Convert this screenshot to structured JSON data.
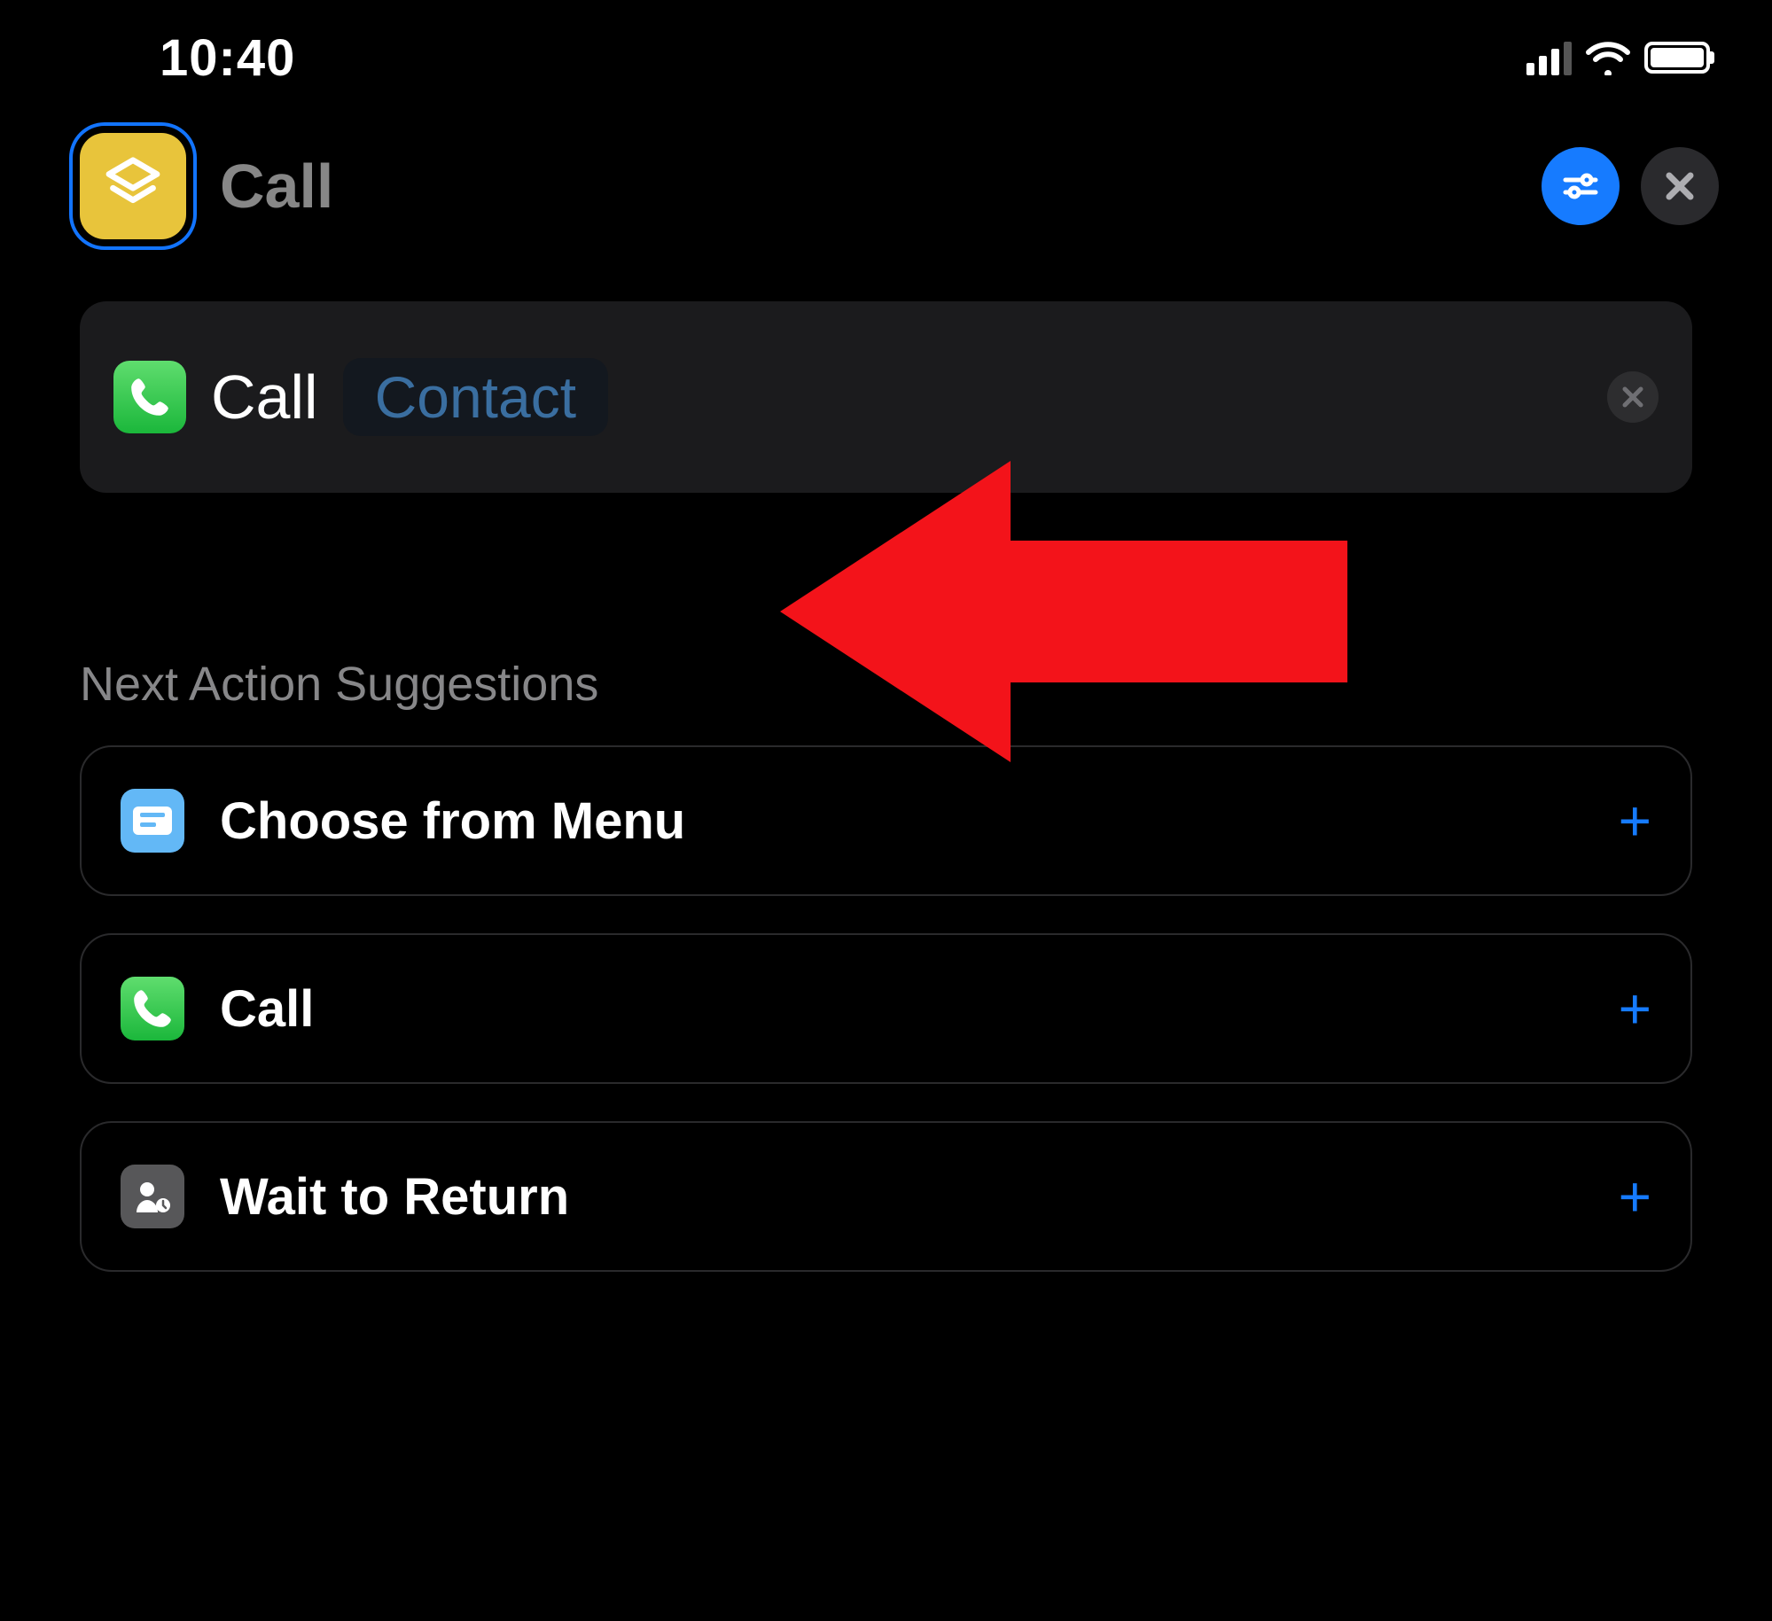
{
  "status": {
    "time": "10:40"
  },
  "header": {
    "title": "Call"
  },
  "action": {
    "icon": "phone-icon",
    "label": "Call",
    "parameter_token": "Contact"
  },
  "suggestions": {
    "heading": "Next Action Suggestions",
    "items": [
      {
        "icon": "menu-icon",
        "label": "Choose from Menu"
      },
      {
        "icon": "phone-icon",
        "label": "Call"
      },
      {
        "icon": "person-wait-icon",
        "label": "Wait to Return"
      }
    ]
  },
  "annotation": {
    "arrow_color": "#f3131a"
  },
  "colors": {
    "accent": "#167bff"
  }
}
